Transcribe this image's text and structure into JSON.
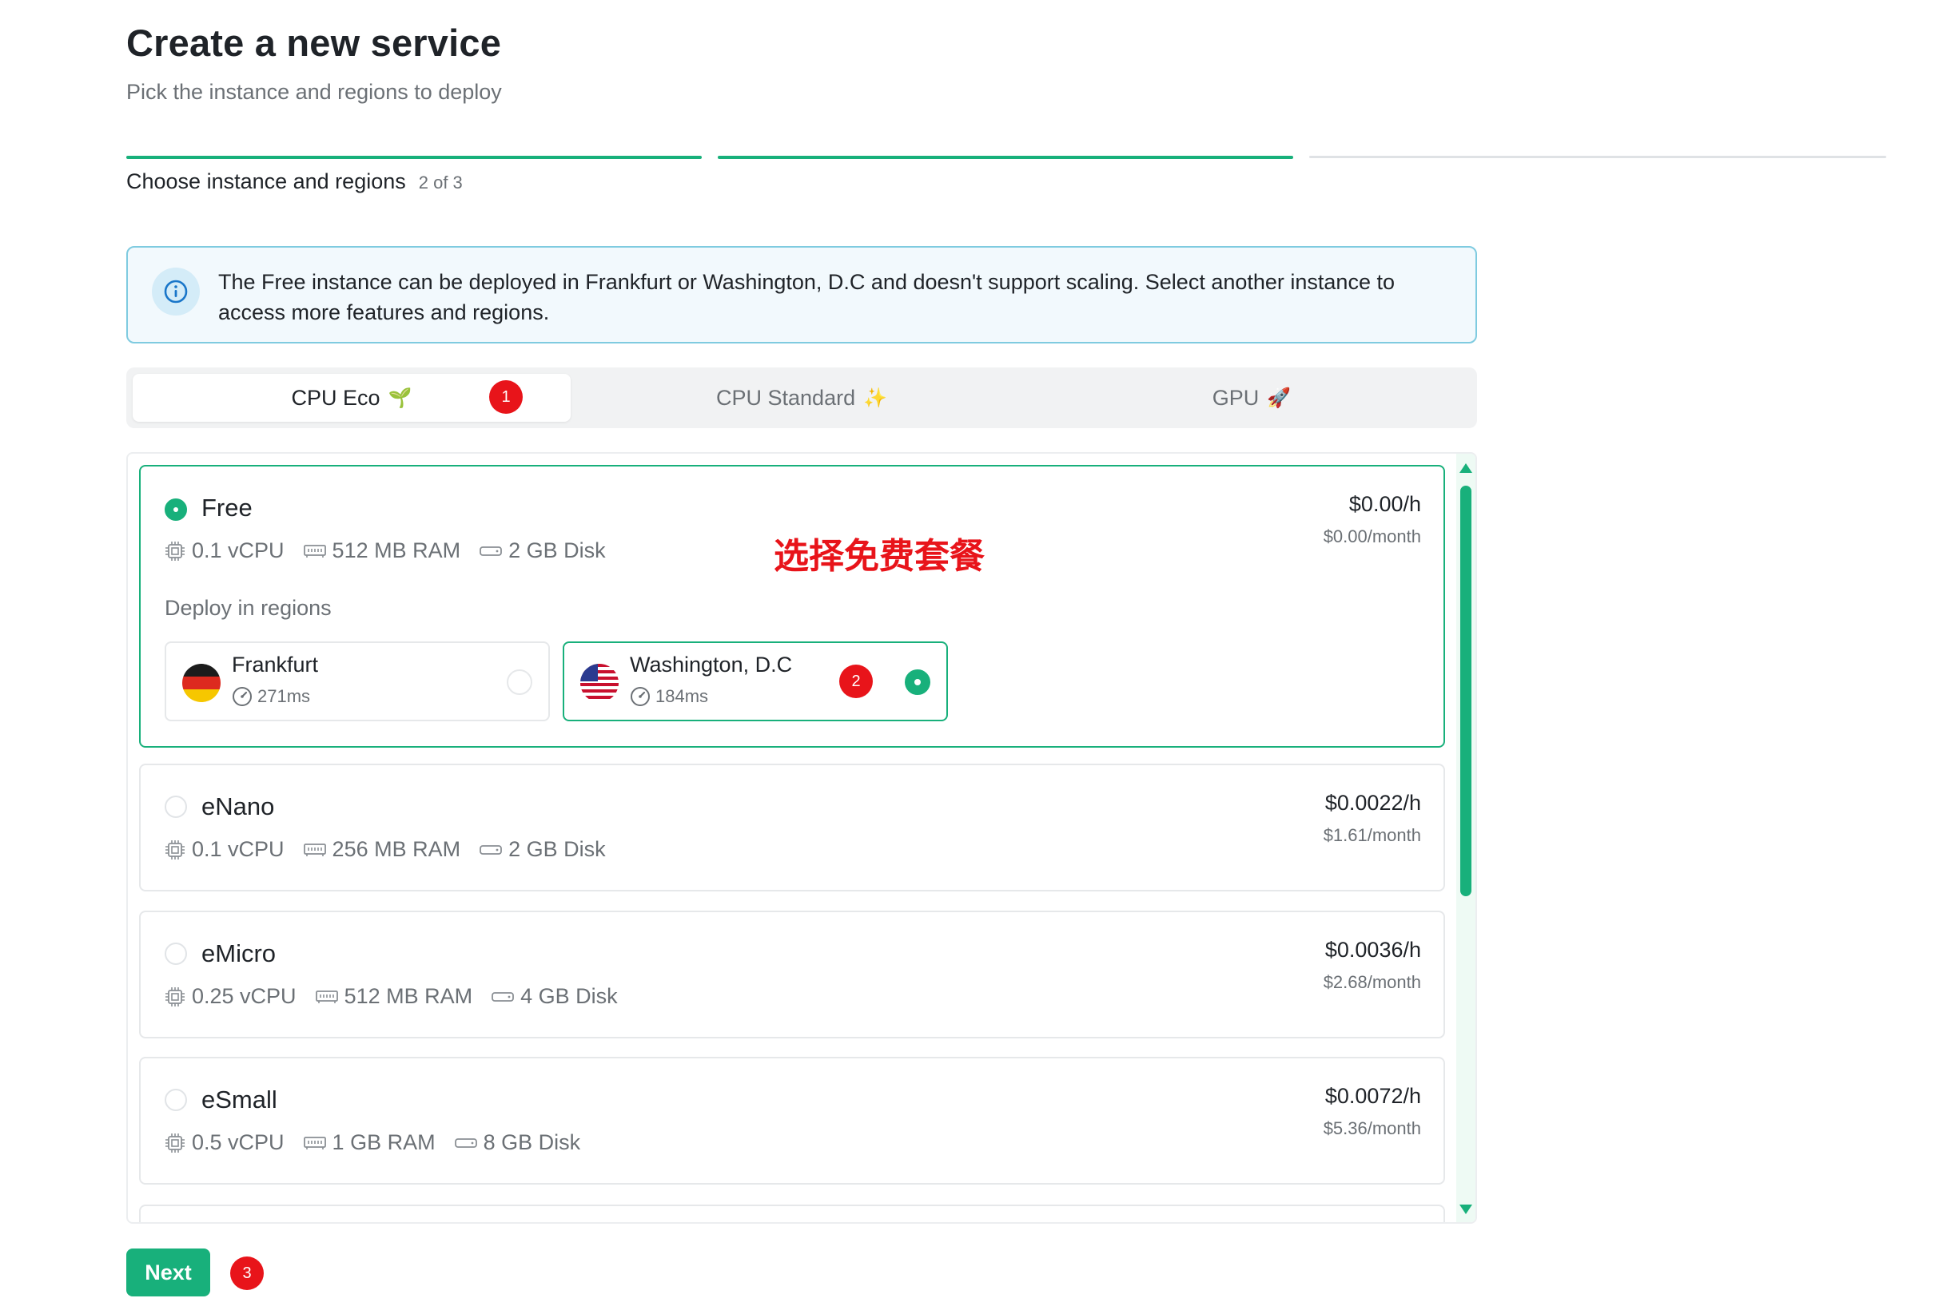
{
  "header": {
    "title": "Create a new service",
    "subtitle": "Pick the instance and regions to deploy"
  },
  "steps": {
    "current_label": "Choose instance and regions",
    "count": "2 of 3",
    "completed": 2,
    "total": 3
  },
  "alert": {
    "icon": "info-icon",
    "text": "The Free instance can be deployed in Frankfurt or Washington, D.C and doesn't support scaling. Select another instance to access more features and regions."
  },
  "tabs": [
    {
      "label": "CPU Eco",
      "emoji": "🌱",
      "active": true
    },
    {
      "label": "CPU Standard",
      "emoji": "✨",
      "active": false
    },
    {
      "label": "GPU",
      "emoji": "🚀",
      "active": false
    }
  ],
  "annotation_badges": {
    "tab": "1",
    "region": "2",
    "next": "3"
  },
  "annotation_text": "选择免费套餐",
  "plans": [
    {
      "name": "Free",
      "selected": true,
      "vcpu": "0.1 vCPU",
      "ram": "512 MB RAM",
      "disk": "2 GB Disk",
      "price_hour": "$0.00/h",
      "price_month": "$0.00/month"
    },
    {
      "name": "eNano",
      "selected": false,
      "vcpu": "0.1 vCPU",
      "ram": "256 MB RAM",
      "disk": "2 GB Disk",
      "price_hour": "$0.0022/h",
      "price_month": "$1.61/month"
    },
    {
      "name": "eMicro",
      "selected": false,
      "vcpu": "0.25 vCPU",
      "ram": "512 MB RAM",
      "disk": "4 GB Disk",
      "price_hour": "$0.0036/h",
      "price_month": "$2.68/month"
    },
    {
      "name": "eSmall",
      "selected": false,
      "vcpu": "0.5 vCPU",
      "ram": "1 GB RAM",
      "disk": "8 GB Disk",
      "price_hour": "$0.0072/h",
      "price_month": "$5.36/month"
    }
  ],
  "regions": {
    "label": "Deploy in regions",
    "items": [
      {
        "name": "Frankfurt",
        "latency": "271ms",
        "flag": "germany-flag",
        "selected": false
      },
      {
        "name": "Washington, D.C",
        "latency": "184ms",
        "flag": "usa-flag",
        "selected": true
      }
    ]
  },
  "footer": {
    "next_label": "Next"
  },
  "colors": {
    "accent": "#18b07b",
    "badge": "#e8141a",
    "alert_bg": "#f2f9fd",
    "alert_border": "#7fcbe0"
  }
}
